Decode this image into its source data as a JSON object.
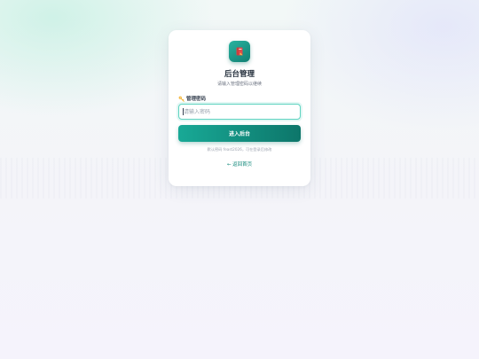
{
  "login": {
    "logo_icon": "book-icon",
    "title": "后台管理",
    "subtitle": "请输入管理密码以继续",
    "password_label": "管理密码",
    "password_label_icon": "key-icon",
    "password_placeholder": "请输入密码",
    "password_value": "",
    "submit_label": "进入后台",
    "hint": "默认密码 feast2026，可在登录后修改",
    "back_link": "← 返回首页"
  },
  "colors": {
    "accent": "#0f8a7c",
    "accent_light": "#5fd3c0",
    "logo_book": "#e0484b"
  }
}
